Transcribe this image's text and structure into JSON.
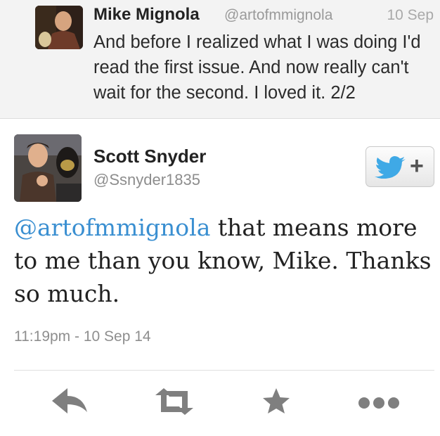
{
  "parent_tweet": {
    "name": "Mike Mignola",
    "handle": "@artofmmignola",
    "date": "10 Sep",
    "text": "And before I realized what I was doing I'd read the first issue. And now really can't wait for the second. I loved it. 2/2"
  },
  "main_tweet": {
    "name": "Scott Snyder",
    "handle": "@Ssnyder1835",
    "mention": "@artofmmignola",
    "text_rest": " that means more to me than you know, Mike. Thanks so much.",
    "timestamp": "11:19pm - 10 Sep 14"
  },
  "follow_button": {
    "icon": "twitter-bird-icon",
    "symbol": "+"
  },
  "actions": [
    {
      "icon": "reply-icon"
    },
    {
      "icon": "retweet-icon"
    },
    {
      "icon": "favorite-star-icon"
    },
    {
      "icon": "more-dots-icon"
    }
  ],
  "colors": {
    "mention": "#3a8fd1",
    "bird": "#3fa9e6",
    "action_icons": "#7f7f7f"
  }
}
